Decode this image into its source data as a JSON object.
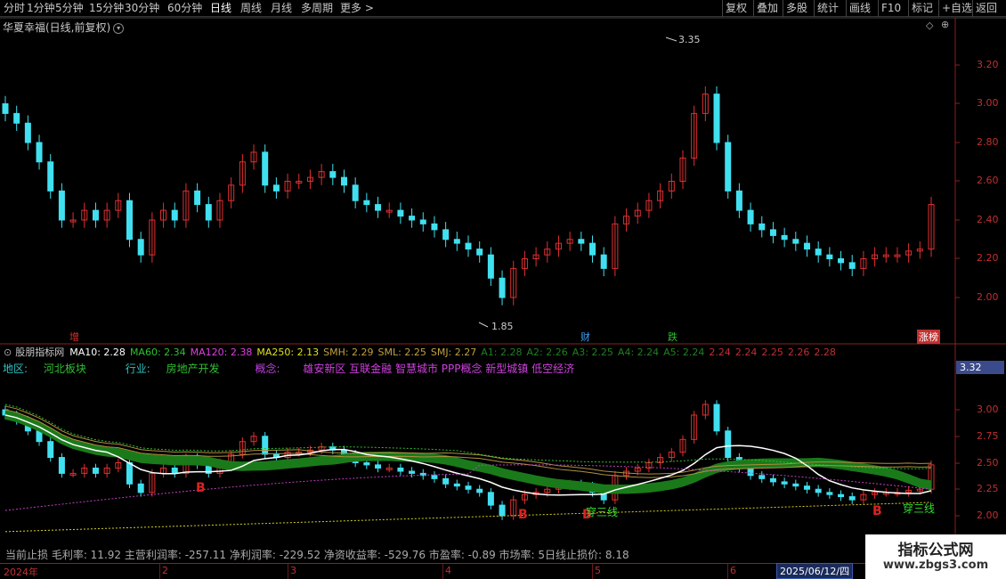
{
  "toolbar": {
    "left": [
      "分时",
      "1分钟",
      "5分钟",
      "15分钟",
      "30分钟",
      "60分钟",
      "日线",
      "周线",
      "月线",
      "多周期",
      "更多 >"
    ],
    "right": [
      "复权",
      "叠加",
      "多股",
      "统计",
      "画线",
      "F10",
      "标记",
      "+自选",
      "返回"
    ],
    "active": "日线"
  },
  "title": "华夏幸福(日线,前复权)",
  "main_axis": [
    "3.20",
    "3.00",
    "2.80",
    "2.60",
    "2.40",
    "2.20",
    "2.00"
  ],
  "annotations": {
    "high": "3.35",
    "low": "1.85",
    "markers": [
      "增",
      "财",
      "跌",
      "涨榜"
    ]
  },
  "indicator_name": "股朋指标网",
  "ma_row": [
    {
      "text": "MA10: 2.28",
      "color": "#ffffff"
    },
    {
      "text": "MA60: 2.34",
      "color": "#30c030"
    },
    {
      "text": "MA120: 2.38",
      "color": "#e040e0"
    },
    {
      "text": "MA250: 2.13",
      "color": "#e0e020"
    },
    {
      "text": "SMH: 2.29",
      "color": "#c0a040"
    },
    {
      "text": "SML: 2.25",
      "color": "#c0a040"
    },
    {
      "text": "SMJ: 2.27",
      "color": "#c0a040"
    },
    {
      "text": "A1: 2.28",
      "color": "#208020"
    },
    {
      "text": "A2: 2.26",
      "color": "#208020"
    },
    {
      "text": "A3: 2.25",
      "color": "#208020"
    },
    {
      "text": "A4: 2.24",
      "color": "#208020"
    },
    {
      "text": "A5: 2.24",
      "color": "#208020"
    },
    {
      "text": "2.24",
      "color": "#c03030"
    },
    {
      "text": "2.24",
      "color": "#c03030"
    },
    {
      "text": "2.25",
      "color": "#c03030"
    },
    {
      "text": "2.26",
      "color": "#c03030"
    },
    {
      "text": "2.28",
      "color": "#c03030"
    }
  ],
  "info": {
    "region_label": "地区:",
    "region": "河北板块",
    "industry_label": "行业:",
    "industry": "房地产开发",
    "concept_label": "概念:",
    "concepts": "雄安新区 互联金融 智慧城市 PPP概念 新型城镇 低空经济"
  },
  "sub_axis": [
    "3.00",
    "2.75",
    "2.50",
    "2.25",
    "2.00"
  ],
  "price_box": "3.32",
  "signals": {
    "buy": "B",
    "cross": "穿三线"
  },
  "bottom_text": "当前止损 毛利率: 11.92 主营利润率: -257.11 净利润率: -229.52 净资收益率: -529.76 市盈率: -0.89 市场率: 5日线止损价: 8.18",
  "dates": [
    "2024年",
    "2",
    "3",
    "4",
    "5",
    "6"
  ],
  "current_date": "2025/06/12/四",
  "watermark": {
    "line1": "指标公式网",
    "line2": "www.zbgs3.com"
  },
  "colors": {
    "up": "#e03030",
    "down": "#40e0f0",
    "axis": "#8a2020"
  }
}
